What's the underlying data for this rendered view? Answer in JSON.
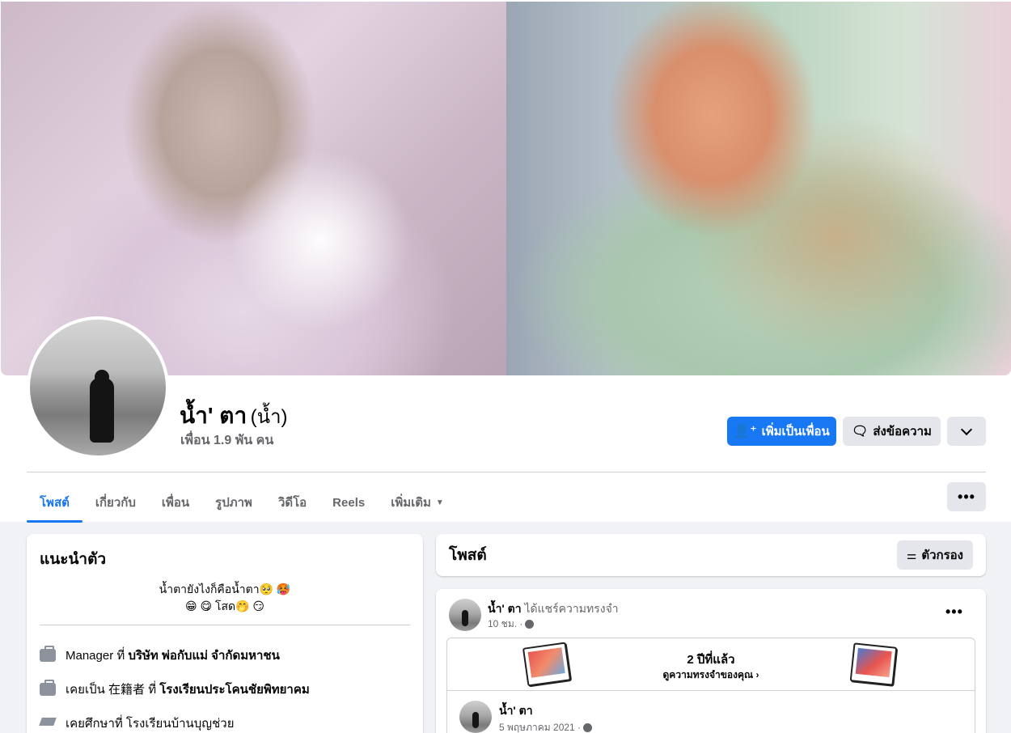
{
  "profile": {
    "name": "น้ำ' ตา",
    "alt_name": "(น้ำ)",
    "friends_count": "เพื่อน 1.9 พัน คน"
  },
  "actions": {
    "add_friend": "เพิ่มเป็นเพื่อน",
    "message": "ส่งข้อความ",
    "add_friend_icon": "person-add-icon",
    "message_icon": "messenger-icon",
    "more_icon": "chevron-down-icon"
  },
  "tabs": [
    {
      "label": "โพสต์",
      "active": true
    },
    {
      "label": "เกี่ยวกับ"
    },
    {
      "label": "เพื่อน"
    },
    {
      "label": "รูปภาพ"
    },
    {
      "label": "วิดีโอ"
    },
    {
      "label": "Reels"
    },
    {
      "label": "เพิ่มเติม"
    }
  ],
  "tab_more_dots": "•••",
  "intro": {
    "title": "แนะนำตัว",
    "bio_line1": "น้ำตายังไงก็คือน้ำตา🥺 🥵",
    "bio_line2": "😁 😋 โสด🤭 😏",
    "work": {
      "prefix": "Manager ที่",
      "place": "บริษัท พ่อกับแม่ จำกัดมหาชน"
    },
    "former": {
      "prefix": "เคยเป็น 在籍者 ที่",
      "place": "โรงเรียนประโคนชัยพิทยาคม"
    },
    "education": {
      "text": "เคยศึกษาที่ โรงเรียนบ้านบุญช่วย"
    }
  },
  "posts": {
    "title": "โพสต์",
    "filter_label": "ตัวกรอง",
    "filter_icon": "sliders-icon"
  },
  "post": {
    "author": "น้ำ' ตา",
    "action_text": "ได้แชร์ความทรงจำ",
    "time": "10 ชม. ·",
    "more": "•••",
    "memory_title": "2 ปีที่แล้ว",
    "memory_link": "ดูความทรงจำของคุณ ›",
    "original_author": "น้ำ' ตา",
    "original_time": "5 พฤษภาคม 2021 ·"
  },
  "colors": {
    "primary": "#1877f2",
    "secondary_button": "#e4e6eb",
    "background": "#f0f2f5",
    "muted_text": "#65676b"
  }
}
